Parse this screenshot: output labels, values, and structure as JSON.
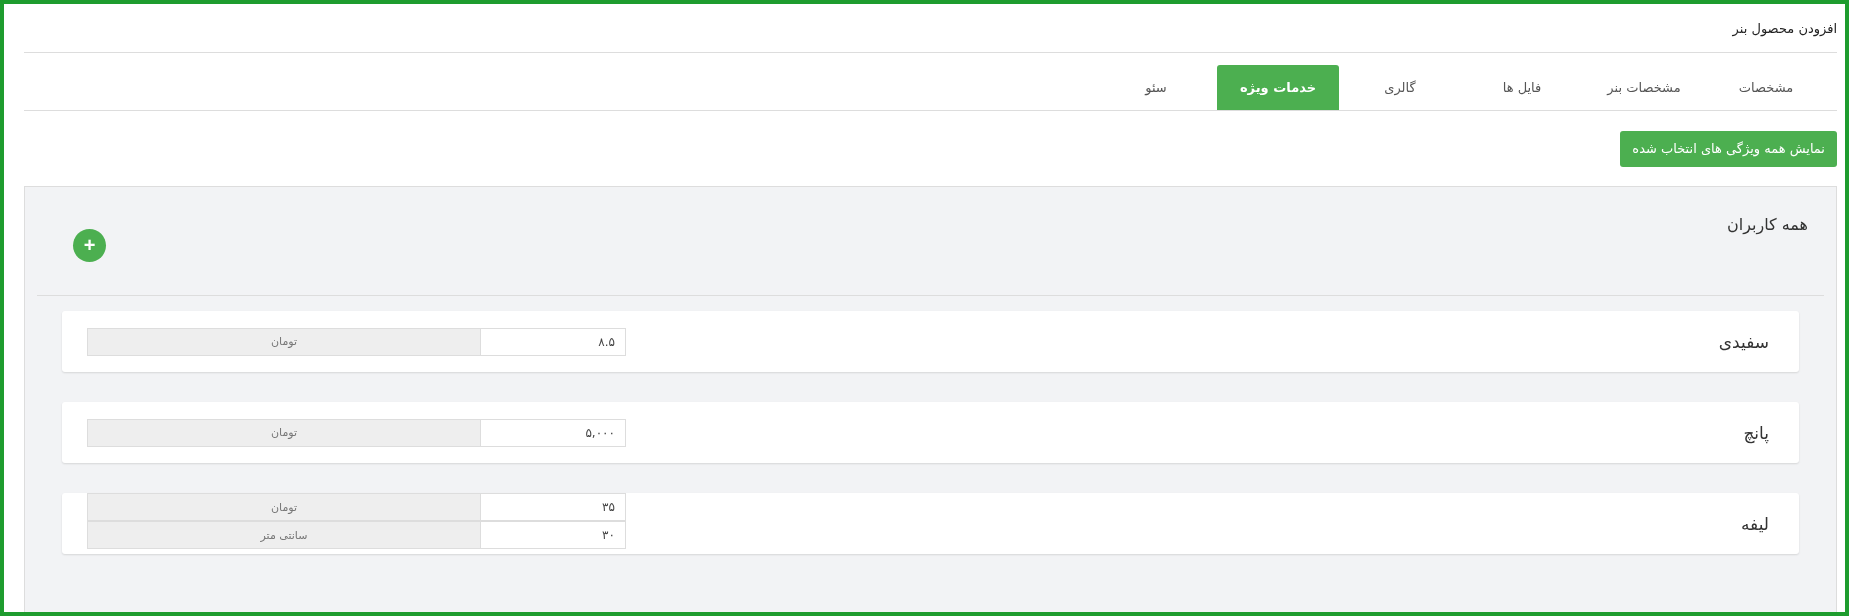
{
  "page": {
    "title": "افزودن محصول بنر"
  },
  "tabs": [
    {
      "label": "مشخصات",
      "selected": false
    },
    {
      "label": "مشخصات بنر",
      "selected": false
    },
    {
      "label": "فایل ها",
      "selected": false
    },
    {
      "label": "گالری",
      "selected": false
    },
    {
      "label": "خدمات ویژه",
      "selected": true
    },
    {
      "label": "سئو",
      "selected": false
    }
  ],
  "show_all_button": "نمایش همه ویژگی های انتخاب شده",
  "panel": {
    "title": "همه کاربران",
    "add_button": "+"
  },
  "services": [
    {
      "name": "سفیدی",
      "fields": [
        {
          "value": "۸.۵",
          "unit": "تومان"
        }
      ]
    },
    {
      "name": "پانچ",
      "fields": [
        {
          "value": "۵,۰۰۰",
          "unit": "تومان"
        }
      ]
    },
    {
      "name": "لیفه",
      "fields": [
        {
          "value": "۳۵",
          "unit": "تومان"
        },
        {
          "value": "۳۰",
          "unit": "سانتی متر"
        }
      ]
    }
  ]
}
